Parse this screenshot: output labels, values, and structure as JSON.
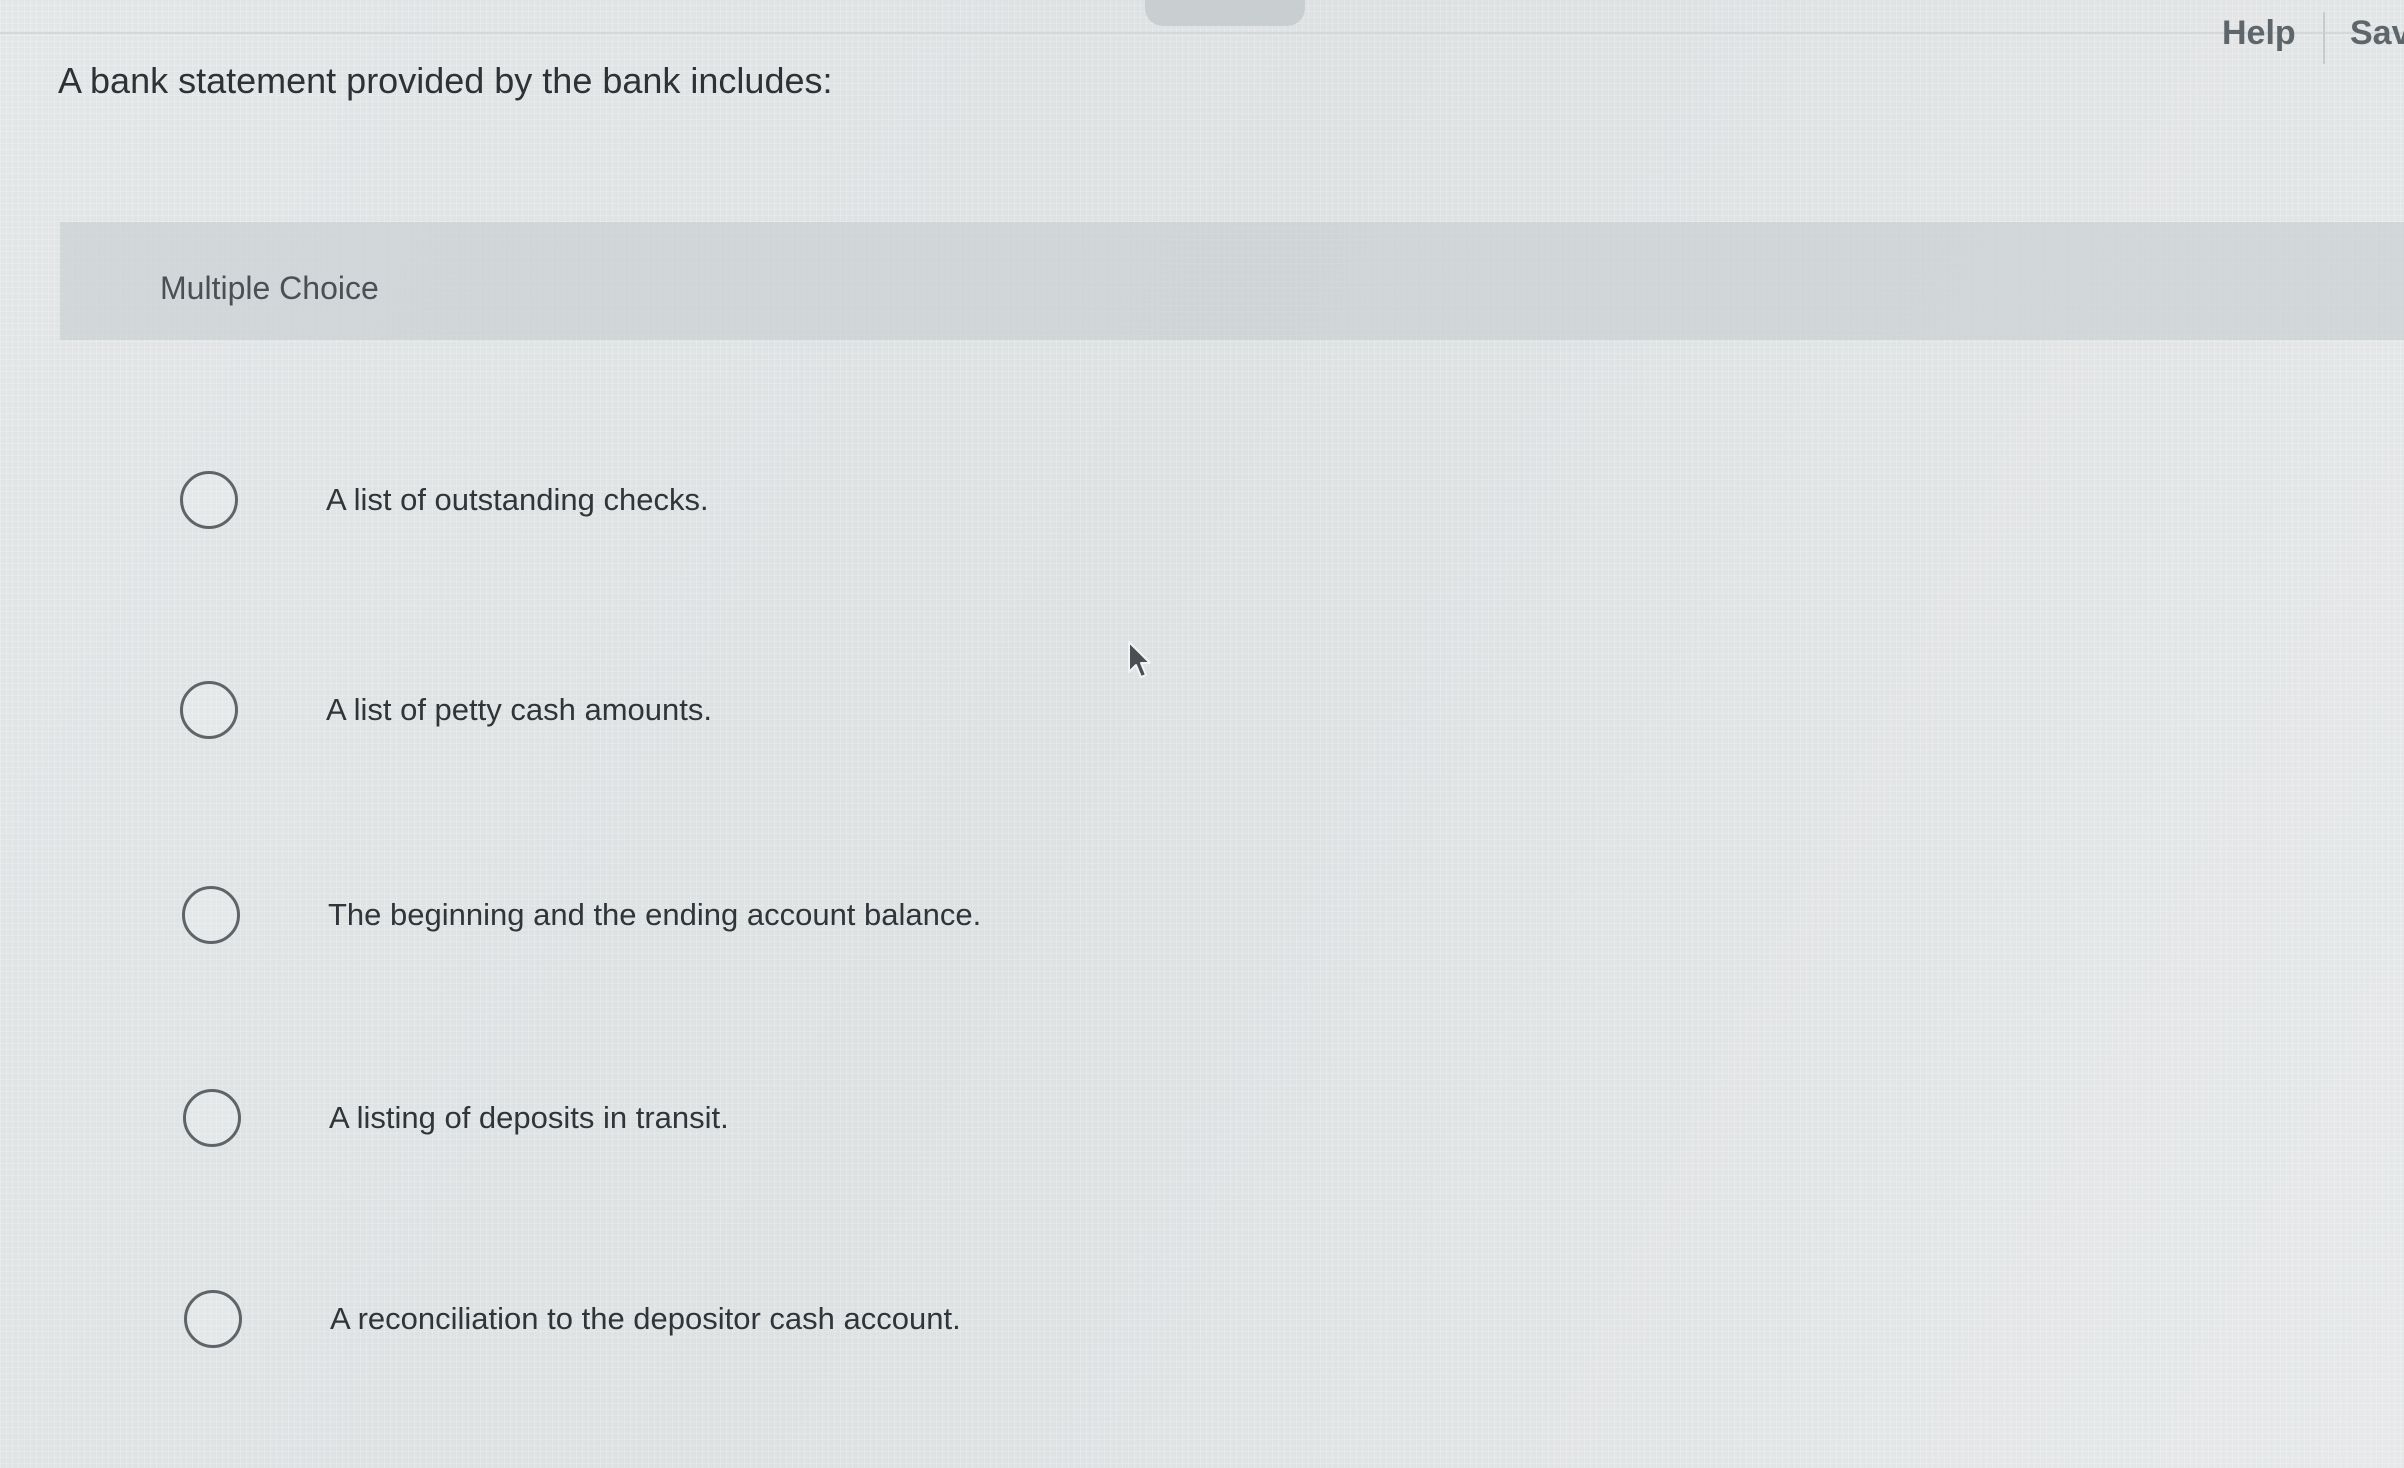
{
  "header": {
    "help_label": "Help",
    "save_label": "Sav"
  },
  "question": {
    "text": "A bank statement provided by the bank includes:",
    "type_label": "Multiple Choice",
    "options": [
      {
        "label": "A list of outstanding checks.",
        "selected": false
      },
      {
        "label": "A list of petty cash amounts.",
        "selected": false
      },
      {
        "label": "The beginning and the ending account balance.",
        "selected": false
      },
      {
        "label": "A listing of deposits in transit.",
        "selected": false
      },
      {
        "label": "A reconciliation to the depositor cash account.",
        "selected": false
      }
    ]
  },
  "icons": {
    "radio": "radio-unselected-icon",
    "cursor": "mouse-pointer-icon"
  }
}
